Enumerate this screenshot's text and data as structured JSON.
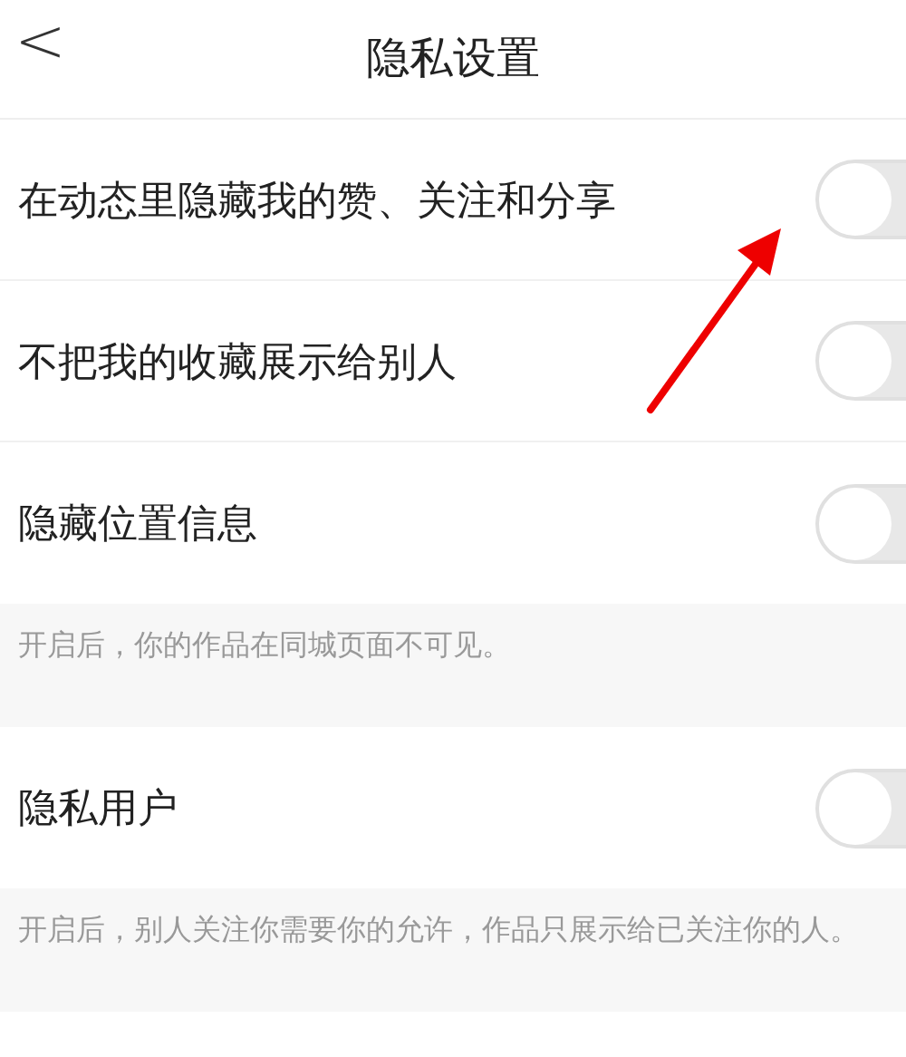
{
  "header": {
    "back": "<",
    "title": "隐私设置"
  },
  "items": [
    {
      "kind": "toggle",
      "label": "在动态里隐藏我的赞、关注和分享",
      "on": false
    },
    {
      "kind": "toggle",
      "label": "不把我的收藏展示给别人",
      "on": false
    },
    {
      "kind": "toggle",
      "label": "隐藏位置信息",
      "on": false
    },
    {
      "kind": "note",
      "text": "开启后，你的作品在同城页面不可见。"
    },
    {
      "kind": "toggle",
      "label": "隐私用户",
      "on": false
    },
    {
      "kind": "note",
      "text": "开启后，别人关注你需要你的允许，作品只展示给已关注你的人。"
    }
  ]
}
